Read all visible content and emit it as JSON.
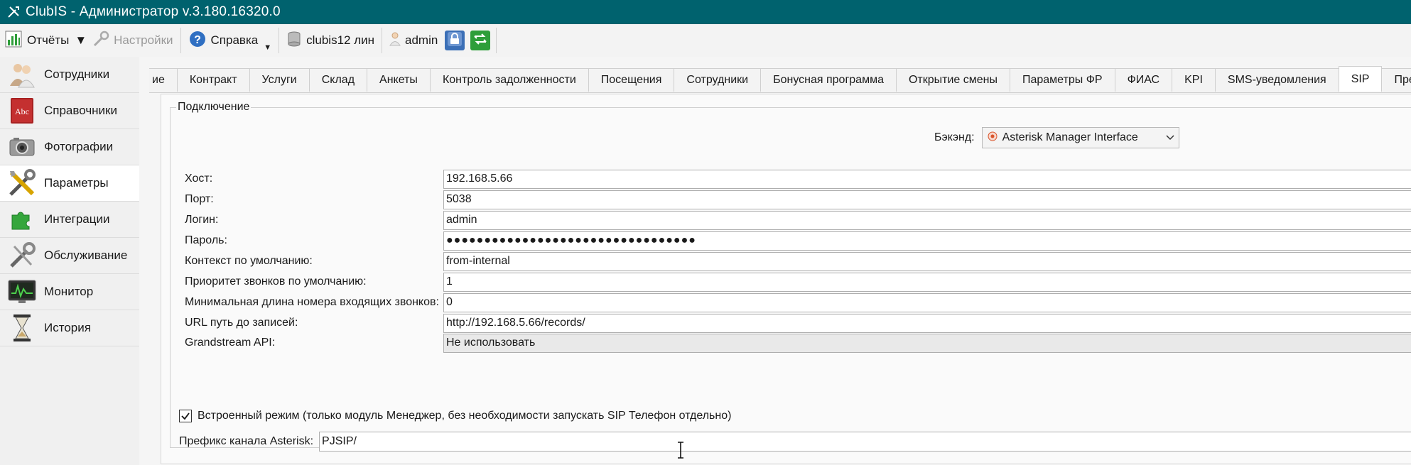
{
  "window": {
    "title": "ClubIS - Администратор v.3.180.16320.0"
  },
  "toolbar": {
    "reports_label": "Отчёты",
    "settings_label": "Настройки",
    "help_label": "Справка",
    "database_label": "clubis12 лин",
    "user_label": "admin"
  },
  "sidebar": {
    "items": [
      {
        "label": "Сотрудники",
        "icon": "employees-icon"
      },
      {
        "label": "Справочники",
        "icon": "book-icon"
      },
      {
        "label": "Фотографии",
        "icon": "camera-icon"
      },
      {
        "label": "Параметры",
        "icon": "tools-icon"
      },
      {
        "label": "Интеграции",
        "icon": "puzzle-icon"
      },
      {
        "label": "Обслуживание",
        "icon": "wrench-icon"
      },
      {
        "label": "Монитор",
        "icon": "monitor-icon"
      },
      {
        "label": "История",
        "icon": "hourglass-icon"
      }
    ],
    "active_index": 3
  },
  "tabs": [
    "ие",
    "Контракт",
    "Услуги",
    "Склад",
    "Анкеты",
    "Контроль задолженности",
    "Посещения",
    "Сотрудники",
    "Бонусная программа",
    "Открытие смены",
    "Параметры ФР",
    "ФИАС",
    "KPI",
    "SMS-уведомления",
    "SIP",
    "Пред"
  ],
  "active_tab": "SIP",
  "form": {
    "group_title": "Подключение",
    "backend_label": "Бэкэнд:",
    "backend_value": "Asterisk Manager Interface",
    "host_label": "Хост:",
    "host_value": "192.168.5.66",
    "port_label": "Порт:",
    "port_value": "5038",
    "login_label": "Логин:",
    "login_value": "admin",
    "password_label": "Пароль:",
    "password_value": "●●●●●●●●●●●●●●●●●●●●●●●●●●●●●●●●●",
    "context_label": "Контекст по умолчанию:",
    "context_value": "from-internal",
    "priority_label": "Приоритет звонков по умолчанию:",
    "priority_value": "1",
    "minlen_label": "Минимальная длина номера входящих звонков:",
    "minlen_value": "0",
    "url_label": "URL путь до записей:",
    "url_value": "http://192.168.5.66/records/",
    "grandstream_label": "Grandstream API:",
    "grandstream_value": "Не использовать",
    "embedded_label": "Встроенный режим (только модуль Менеджер, без необходимости запускать SIP Телефон отдельно)",
    "embedded_checked": true,
    "prefix_label": "Префикс канала Asterisk:",
    "prefix_value": "PJSIP/"
  },
  "colors": {
    "titlebar": "#00626e",
    "accent_green": "#2e9e3a",
    "lock_blue": "#3b6fb6"
  }
}
